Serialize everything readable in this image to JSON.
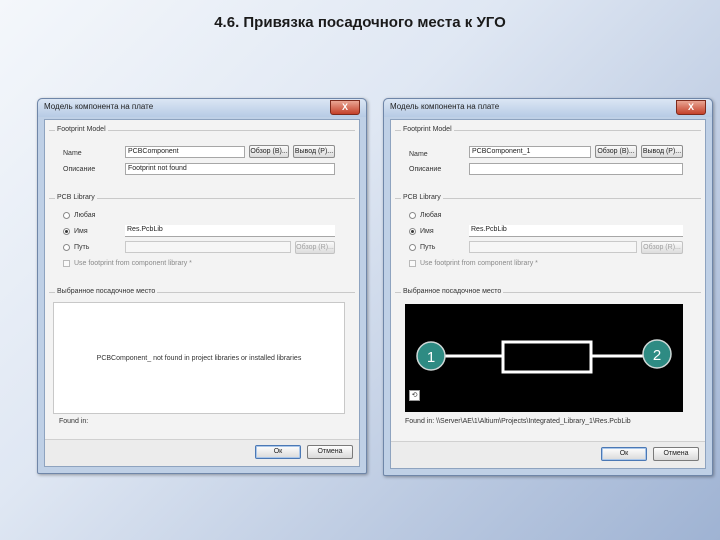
{
  "slide": {
    "title": "4.6. Привязка посадочного места к УГО"
  },
  "left_dialog": {
    "title": "Модель компонента на плате",
    "close": "X",
    "footprint_group": "Footprint Model",
    "name_label": "Name",
    "name_value": "PCBComponent",
    "browse_btn": "Обзор (B)...",
    "pin_map_btn": "Вывод (P)...",
    "desc_label": "Описание",
    "desc_value": "Footprint not found",
    "pcb_group": "PCB Library",
    "radio_any": "Любая",
    "radio_name": "Имя",
    "lib_name_value": "Res.PcbLib",
    "radio_path": "Путь",
    "path_browse": "Обзор (R)...",
    "use_footprint": "Use footprint from component library *",
    "selected_group": "Выбранное посадочное место",
    "preview_message": "PCBComponent_ not found in project libraries or installed libraries",
    "found_in_label": "Found in:",
    "ok": "Ок",
    "cancel": "Отмена"
  },
  "right_dialog": {
    "title": "Модель компонента на плате",
    "close": "X",
    "footprint_group": "Footprint Model",
    "name_label": "Name",
    "name_value": "PCBComponent_1",
    "browse_btn": "Обзор (B)...",
    "pin_map_btn": "Вывод (P)...",
    "desc_label": "Описание",
    "desc_value": "",
    "pcb_group": "PCB Library",
    "radio_any": "Любая",
    "radio_name": "Имя",
    "lib_name_value": "Res.PcbLib",
    "radio_path": "Путь",
    "path_browse": "Обзор (R)...",
    "use_footprint": "Use footprint from component library *",
    "selected_group": "Выбранное посадочное место",
    "pad1": "1",
    "pad2": "2",
    "found_in": "Found in:  \\\\Server\\AE\\1\\Altium\\Projects\\Integrated_Library_1\\Res.PcbLib",
    "ok": "Ок",
    "cancel": "Отмена"
  },
  "colors": {
    "pad": "#2e8b83",
    "preview_bg": "#000000",
    "body": "#ffffff"
  }
}
